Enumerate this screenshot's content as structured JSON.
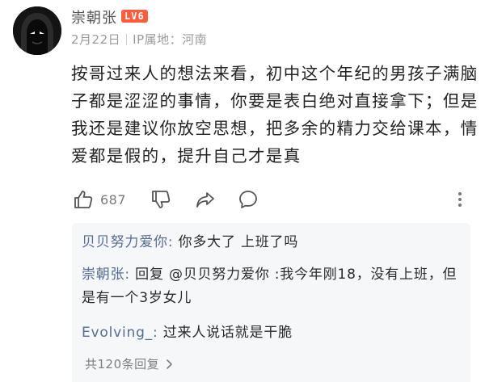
{
  "comment": {
    "username": "崇朝张",
    "level_badge": "LV6",
    "date": "2月22日",
    "ip_location": "IP属地：河南",
    "text": "按哥过来人的想法来看，初中这个年纪的男孩子满脑子都是涩涩的事情，你要是表白绝对直接拿下；但是我还是建议你放空思想，把多余的精力交给课本，情爱都是假的，提升自己才是真",
    "like_count": "687",
    "icons": [
      "thumbs-up-icon",
      "thumbs-down-icon",
      "share-icon",
      "comment-icon",
      "more-icon"
    ]
  },
  "replies": {
    "items": [
      {
        "author": "贝贝努力爱你",
        "separator": ": ",
        "text": "你多大了 上班了吗"
      },
      {
        "author": "崇朝张",
        "separator": ": ",
        "text": "回复 @贝贝努力爱你 :我今年刚18，没有上班，但是有一个3岁女儿"
      },
      {
        "author": "Evolving_",
        "separator": ": ",
        "text": "过来人说话就是干脆"
      }
    ],
    "more_label": "共120条回复"
  },
  "colors": {
    "link_blue": "#576b95",
    "badge_red": "#ff5a3a",
    "reply_bg": "#f6f7f9"
  }
}
